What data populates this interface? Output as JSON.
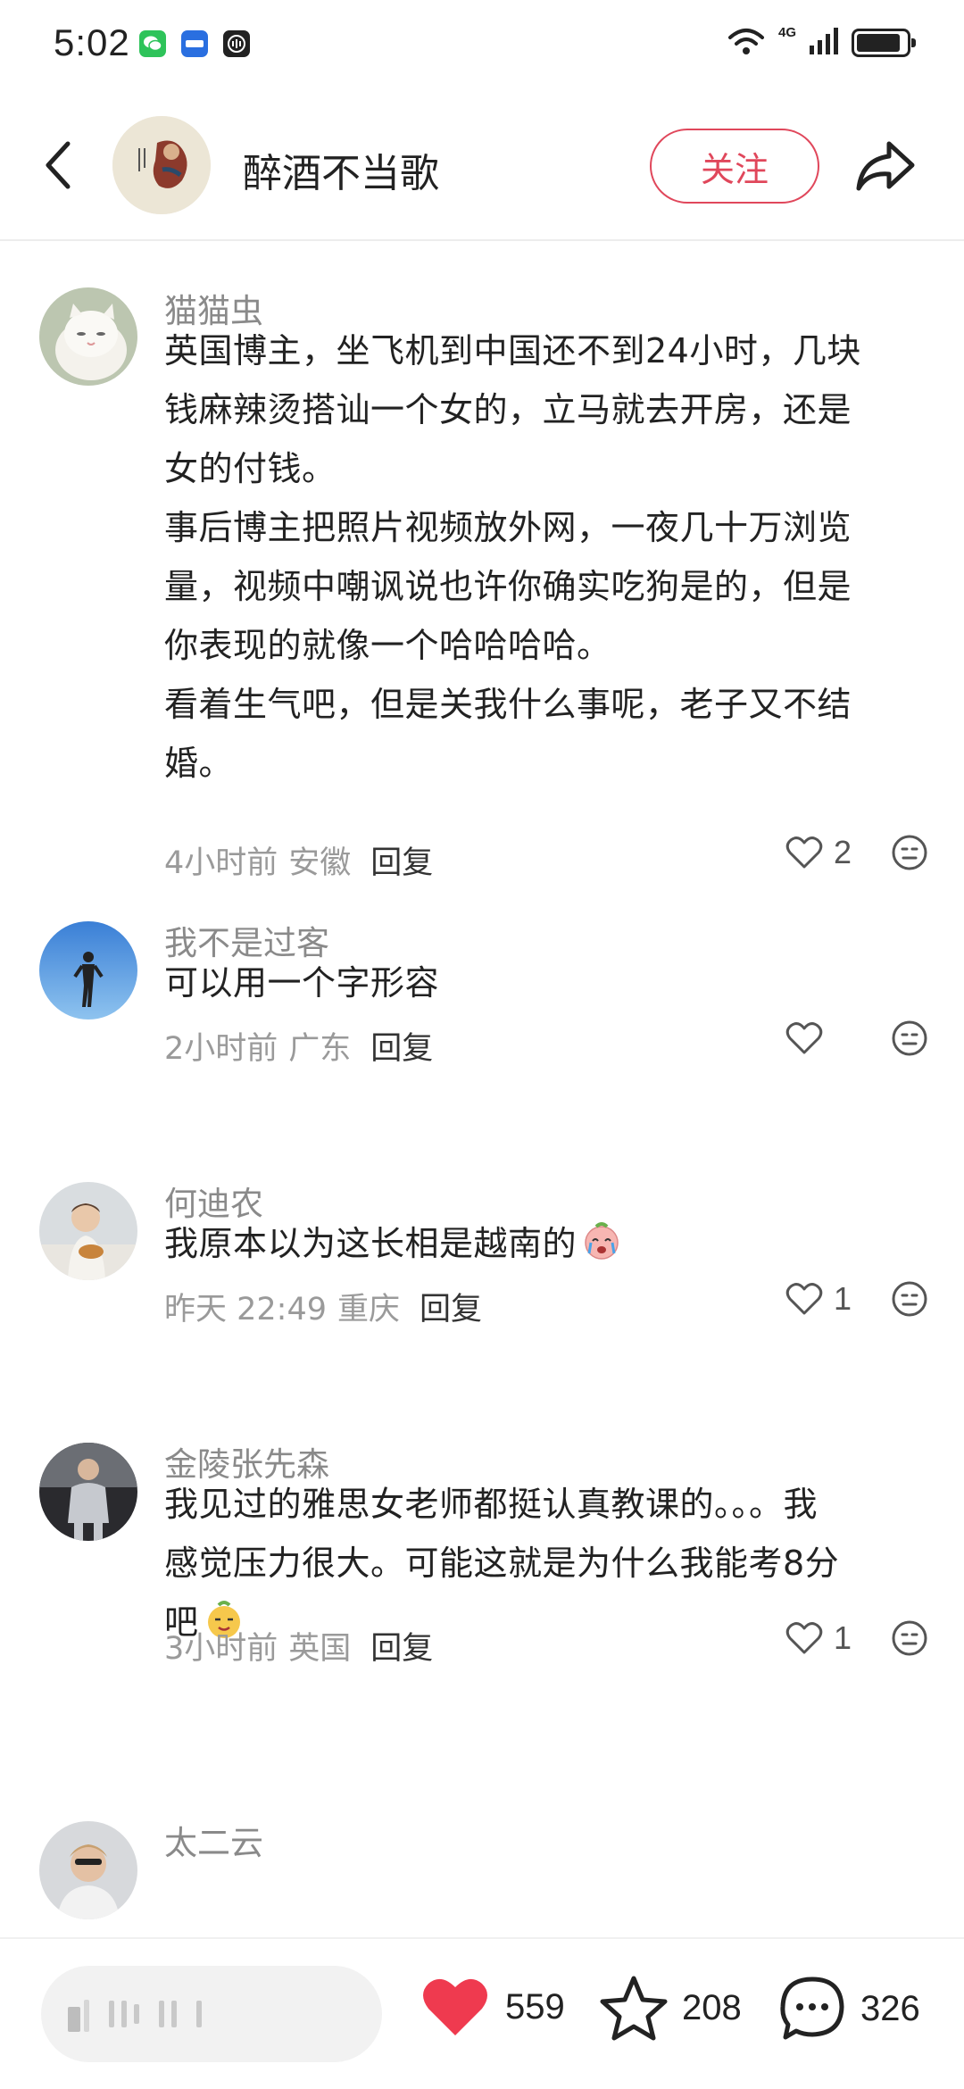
{
  "status_bar": {
    "time": "5:02",
    "network": "4G",
    "battery_level": 0.88
  },
  "header": {
    "title": "醉酒不当歌",
    "follow_label": "关注"
  },
  "comments": [
    {
      "user": "猫猫虫",
      "lines": [
        "英国博主，坐飞机到中国还不到24小时，几块",
        "钱麻辣烫搭讪一个女的，立马就去开房，还是",
        "女的付钱。",
        "事后博主把照片视频放外网，一夜几十万浏览",
        "量，视频中嘲讽说也许你确实吃狗是的，但是",
        "你表现的就像一个哈哈哈哈。",
        "看着生气吧，但是关我什么事呢，老子又不结",
        "婚。"
      ],
      "time": "4小时前",
      "location": "安徽",
      "reply": "回复",
      "likes": "2"
    },
    {
      "user": "我不是过客",
      "lines": [
        "可以用一个字形容"
      ],
      "time": "2小时前",
      "location": "广东",
      "reply": "回复",
      "likes": ""
    },
    {
      "user": "何迪农",
      "lines": [
        "我原本以为这长相是越南的"
      ],
      "time": "昨天 22:49",
      "location": "重庆",
      "reply": "回复",
      "likes": "1"
    },
    {
      "user": "金陵张先森",
      "lines": [
        "我见过的雅思女老师都挺认真教课的。。。我",
        "感觉压力很大。可能这就是为什么我能考8分",
        "吧"
      ],
      "time": "3小时前",
      "location": "英国",
      "reply": "回复",
      "likes": "1"
    },
    {
      "user": "太二云",
      "lines": []
    }
  ],
  "bottom_bar": {
    "likes": "559",
    "stars": "208",
    "comments": "326",
    "like_color": "#ef3a4f"
  }
}
